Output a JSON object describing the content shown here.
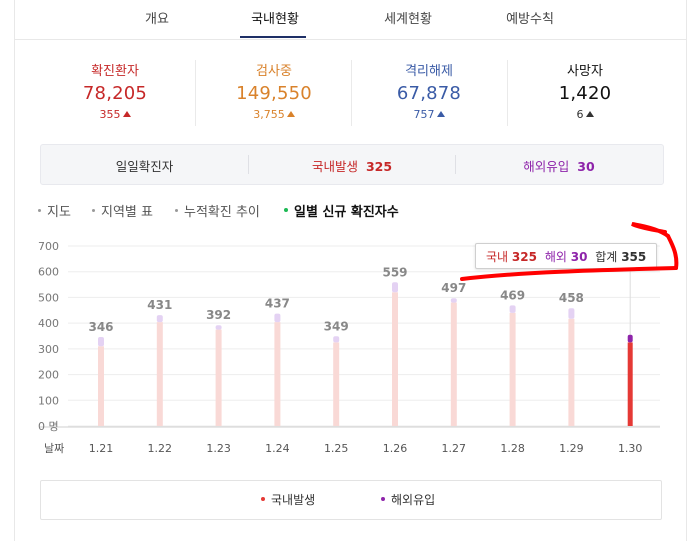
{
  "tabs": [
    {
      "label": "개요",
      "active": false
    },
    {
      "label": "국내현황",
      "active": true
    },
    {
      "label": "세계현황",
      "active": false
    },
    {
      "label": "예방수칙",
      "active": false
    }
  ],
  "stats": [
    {
      "label": "확진환자",
      "value": "78,205",
      "delta": "355",
      "color": "#c62828",
      "delta_color": "#c62828"
    },
    {
      "label": "검사중",
      "value": "149,550",
      "delta": "3,755",
      "color": "#d9822b",
      "delta_color": "#d9822b"
    },
    {
      "label": "격리해제",
      "value": "67,878",
      "delta": "757",
      "color": "#3a5ba6",
      "delta_color": "#3a5ba6"
    },
    {
      "label": "사망자",
      "value": "1,420",
      "delta": "6",
      "color": "#111111",
      "delta_color": "#333333"
    }
  ],
  "daily": {
    "label": "일일확진자",
    "domestic_label": "국내발생",
    "domestic_value": "325",
    "overseas_label": "해외유입",
    "overseas_value": "30"
  },
  "subnav": [
    {
      "label": "지도",
      "active": false
    },
    {
      "label": "지역별 표",
      "active": false
    },
    {
      "label": "누적확진 추이",
      "active": false
    },
    {
      "label": "일별 신규 확진자수",
      "active": true
    }
  ],
  "chart_data": {
    "type": "bar",
    "stacked": true,
    "x_axis_label": "날짜",
    "categories": [
      "1.21",
      "1.22",
      "1.23",
      "1.24",
      "1.25",
      "1.26",
      "1.27",
      "1.28",
      "1.29",
      "1.30"
    ],
    "totals": [
      346,
      431,
      392,
      437,
      349,
      559,
      497,
      469,
      458,
      355
    ],
    "series": [
      {
        "name": "국내발생",
        "color": "#f9d9d6",
        "highlight_color": "#e53935",
        "values": [
          310,
          404,
          375,
          404,
          325,
          520,
          480,
          440,
          417,
          325
        ]
      },
      {
        "name": "해외유입",
        "color": "#e4d2f3",
        "highlight_color": "#8e24aa",
        "values": [
          36,
          27,
          17,
          33,
          24,
          39,
          17,
          29,
          41,
          30
        ]
      }
    ],
    "yticks": [
      "700",
      "600",
      "500",
      "400",
      "300",
      "200",
      "100",
      "0 명"
    ],
    "ylim": [
      0,
      700
    ],
    "highlight_index": 9,
    "show_value_labels_except_highlight": true
  },
  "tooltip": {
    "domestic_label": "국내",
    "domestic_value": "325",
    "overseas_label": "해외",
    "overseas_value": "30",
    "total_label": "합계",
    "total_value": "355"
  },
  "legend": [
    {
      "label": "국내발생",
      "color": "#e53935"
    },
    {
      "label": "해외유입",
      "color": "#8e24aa"
    }
  ],
  "colors": {
    "domestic": "#c62828",
    "overseas": "#8e24aa",
    "annotation": "#ff0000"
  }
}
